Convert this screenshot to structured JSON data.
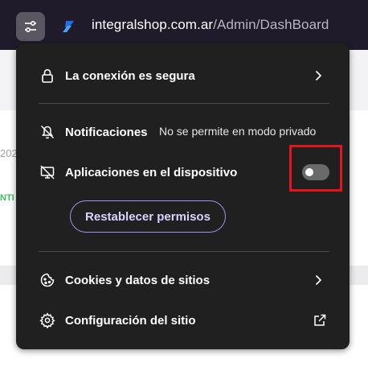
{
  "address_bar": {
    "domain": "integralshop.com.ar",
    "path": "/Admin/DashBoard"
  },
  "background": {
    "fragment_1": "202",
    "fragment_2": "NTI"
  },
  "popup": {
    "connection": {
      "label": "La conexión es segura",
      "icon": "lock-icon"
    },
    "notifications": {
      "label": "Notificaciones",
      "status": "No se permite en modo privado",
      "icon": "bell-off-icon"
    },
    "apps": {
      "label": "Aplicaciones en el dispositivo",
      "icon": "device-off-icon",
      "toggle_on": false
    },
    "reset_button": "Restablecer permisos",
    "cookies": {
      "label": "Cookies y datos de sitios",
      "icon": "cookie-icon"
    },
    "site_settings": {
      "label": "Configuración del sitio",
      "icon": "gear-icon"
    }
  },
  "colors": {
    "popup_bg": "#202020",
    "accent": "#9b95e6",
    "highlight": "#e2141c"
  }
}
